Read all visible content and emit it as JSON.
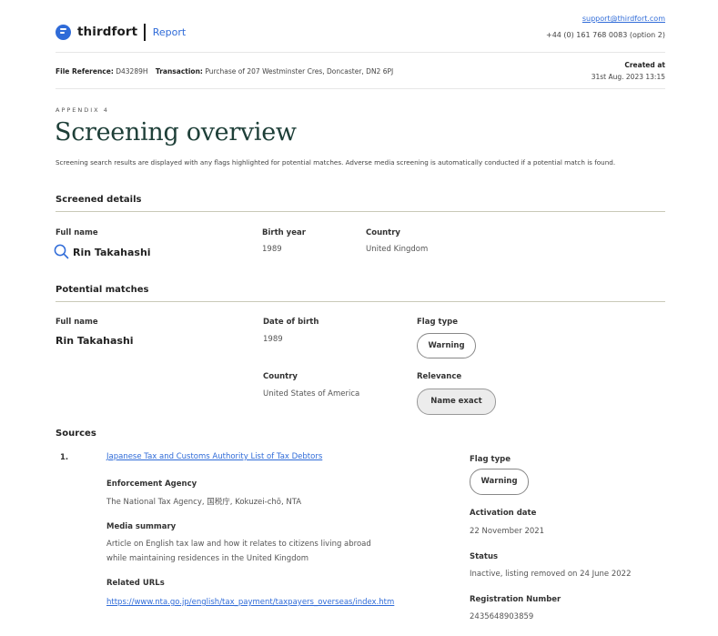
{
  "header": {
    "brand": "thirdfort",
    "section": "Report",
    "support_email": "support@thirdfort.com",
    "support_phone": "+44 (0) 161 768 0083 (option 2)"
  },
  "meta": {
    "file_ref_label": "File Reference:",
    "file_ref_value": "D43289H",
    "transaction_label": "Transaction:",
    "transaction_value": "Purchase of 207 Westminster Cres, Doncaster, DN2 6PJ",
    "created_label": "Created at",
    "created_value": "31st Aug. 2023 13:15"
  },
  "page": {
    "appendix": "APPENDIX 4",
    "title": "Screening overview",
    "intro": "Screening search results are displayed with any flags highlighted for potential matches. Adverse media screening is automatically conducted if a potential match is found."
  },
  "screened": {
    "heading": "Screened details",
    "full_name_label": "Full name",
    "full_name": "Rin Takahashi",
    "birth_year_label": "Birth year",
    "birth_year": "1989",
    "country_label": "Country",
    "country": "United Kingdom"
  },
  "matches": {
    "heading": "Potential matches",
    "full_name_label": "Full name",
    "full_name": "Rin Takahashi",
    "dob_label": "Date of birth",
    "dob": "1989",
    "flag_label": "Flag type",
    "flag": "Warning",
    "country_label": "Country",
    "country": "United States of America",
    "relevance_label": "Relevance",
    "relevance": "Name exact"
  },
  "sources": {
    "heading": "Sources",
    "items": [
      {
        "index": "1.",
        "title": "Japanese Tax and Customs Authority List of Tax Debtors",
        "agency_label": "Enforcement Agency",
        "agency": "The National Tax Agency, 国税庁, Kokuzei-chō, NTA",
        "summary_label": "Media summary",
        "summary_line1": "Article on English tax law and how it relates to citizens living abroad",
        "summary_line2": "while maintaining residences in the United Kingdom",
        "urls_label": "Related URLs",
        "url": "https://www.nta.go.jp/english/tax_payment/taxpayers_overseas/index.htm",
        "flag_label": "Flag type",
        "flag": "Warning",
        "activation_label": "Activation date",
        "activation": "22 November 2021",
        "status_label": "Status",
        "status": "Inactive, listing removed on 24 June 2022",
        "reg_label": "Registration Number",
        "reg": "2435648903859"
      }
    ]
  },
  "colors": {
    "brand_blue": "#2f6bd8",
    "title_green": "#1e3f38",
    "pill_grey": "#ececec"
  },
  "icons": [
    "thirdfort-logo-icon",
    "search-icon"
  ]
}
